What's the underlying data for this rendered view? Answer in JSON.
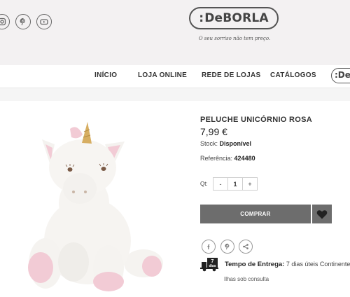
{
  "header": {
    "social": [
      "instagram-icon",
      "pinterest-icon",
      "youtube-icon"
    ],
    "logo_prefix": ":",
    "logo_text": "DeBORLA",
    "tagline": "O seu sorriso não tem preço."
  },
  "nav": {
    "items": [
      "INÍCIO",
      "LOJA ONLINE",
      "REDE DE LOJAS",
      "CATÁLOGOS"
    ],
    "logo_fragment": ":De"
  },
  "product": {
    "title": "PELUCHE UNICÓRNIO ROSA",
    "price": "7,99 €",
    "stock_label": "Stock:",
    "stock_value": "Disponível",
    "ref_label": "Referência:",
    "ref_value": "424480",
    "qty_label": "Qt:",
    "qty_minus": "-",
    "qty_value": "1",
    "qty_plus": "+",
    "buy_label": "COMPRAR",
    "share": [
      "facebook-icon",
      "pinterest-icon",
      "share-icon"
    ],
    "delivery_badge_number": "7",
    "delivery_badge_unit": "dias",
    "delivery_label": "Tempo de Entrega:",
    "delivery_value": "7 dias úteis Continente",
    "islands_note": "Ilhas sob consulta"
  },
  "colors": {
    "header_bg": "#f3f1f2",
    "button_bg": "#6d6d6d",
    "horn": "#d4a85a",
    "pink": "#f2c9d3"
  }
}
